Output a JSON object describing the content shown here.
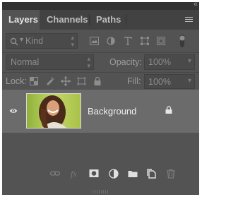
{
  "panel": {
    "collapse_glyph": "«",
    "tabs": [
      {
        "label": "Layers",
        "active": true
      },
      {
        "label": "Channels",
        "active": false
      },
      {
        "label": "Paths",
        "active": false
      }
    ],
    "menu_icon": "panel-menu-icon"
  },
  "filter": {
    "kind_label": "Kind",
    "icons": [
      "pixel-layer-filter-icon",
      "adjustment-layer-filter-icon",
      "type-layer-filter-icon",
      "shape-layer-filter-icon",
      "smart-object-filter-icon",
      "filter-toggle-icon"
    ]
  },
  "blend": {
    "mode": "Normal",
    "opacity_label": "Opacity:",
    "opacity_value": "100%"
  },
  "locks": {
    "label": "Lock:",
    "icons": [
      "lock-transparent-pixels-icon",
      "lock-image-pixels-icon",
      "lock-position-icon",
      "lock-artboard-icon",
      "lock-all-icon"
    ],
    "fill_label": "Fill:",
    "fill_value": "100%"
  },
  "layers": [
    {
      "name": "Background",
      "visible": true,
      "locked": true
    }
  ],
  "footer_icons": [
    "link-layers-icon",
    "fx-icon",
    "add-mask-icon",
    "adjustment-layer-icon",
    "new-group-icon",
    "new-layer-icon",
    "delete-layer-icon"
  ],
  "colors": {
    "panel_bg": "#535353",
    "tabbar_bg": "#424242",
    "selected_layer_bg": "#6b6b6b"
  }
}
